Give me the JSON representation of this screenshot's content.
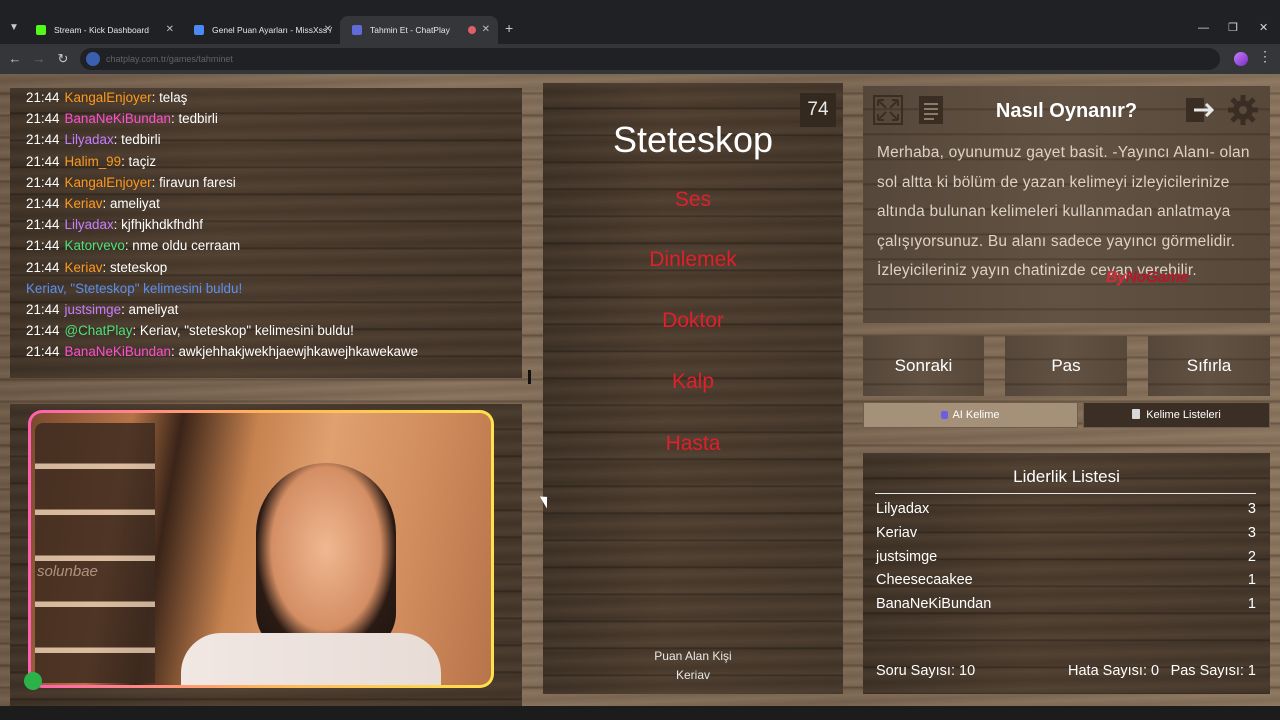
{
  "browser": {
    "tabs": [
      {
        "title": "Stream - Kick Dashboard",
        "favicon_color": "#53fc18",
        "active": false
      },
      {
        "title": "Genel Puan Ayarları - MissXss /",
        "favicon_color": "#4a8af4",
        "active": false
      },
      {
        "title": "Tahmin Et - ChatPlay",
        "favicon_color": "#5f6bd8",
        "active": true
      }
    ],
    "url": "chatplay.com.tr/games/tahminet",
    "new_tab_glyph": "+",
    "window_controls": [
      "—",
      "❐",
      "✕"
    ]
  },
  "chat": {
    "messages": [
      {
        "time": "21:44",
        "user": "KangalEnjoyer",
        "color": "#ff9a1f",
        "text": "telaş"
      },
      {
        "time": "21:44",
        "user": "BanaNeKiBundan",
        "color": "#ff4fd0",
        "text": "tedbirli"
      },
      {
        "time": "21:44",
        "user": "Lilyadax",
        "color": "#c77dff",
        "text": "tedbirli"
      },
      {
        "time": "21:44",
        "user": "Halim_99",
        "color": "#ff9a1f",
        "text": "taçiz"
      },
      {
        "time": "21:44",
        "user": "KangalEnjoyer",
        "color": "#ff9a1f",
        "text": "firavun faresi"
      },
      {
        "time": "21:44",
        "user": "Keriav",
        "color": "#ff9a1f",
        "text": "ameliyat"
      },
      {
        "time": "21:44",
        "user": "Lilyadax",
        "color": "#c77dff",
        "text": "kjfhjkhdkfhdhf"
      },
      {
        "time": "21:44",
        "user": "Katorvevo",
        "color": "#4ee07a",
        "text": "nme oldu cerraam"
      },
      {
        "time": "21:44",
        "user": "Keriav",
        "color": "#ff9a1f",
        "text": "steteskop"
      },
      {
        "system": true,
        "text": "Keriav, \"Steteskop\" kelimesini buldu!"
      },
      {
        "time": "21:44",
        "user": "justsimge",
        "color": "#c77dff",
        "text": "ameliyat"
      },
      {
        "time": "21:44",
        "user": "@ChatPlay",
        "color": "#4ee07a",
        "text": "Keriav, \"steteskop\" kelimesini buldu!"
      },
      {
        "time": "21:44",
        "user": "BanaNeKiBundan",
        "color": "#ff4fd0",
        "text": "awkjehhakjwekhjaewjhkawejhkawekawe"
      }
    ]
  },
  "webcam": {
    "overlay_text": "solunbae"
  },
  "game": {
    "timer": "74",
    "target_word": "Steteskop",
    "forbidden_words": [
      "Ses",
      "Dinlemek",
      "Doktor",
      "Kalp",
      "Hasta"
    ],
    "scorer_label": "Puan Alan Kişi",
    "scorer_name": "Keriav"
  },
  "howto": {
    "title": "Nasıl Oynanır?",
    "text": "Merhaba, oyunumuz gayet basit. -Yayıncı Alanı- olan sol altta ki bölüm de yazan kelimeyi izleyicilerinize altında bulunan kelimeleri kullanmadan anlatmaya çalışıyorsunuz. Bu alanı sadece yayıncı görmelidir. İzleyicileriniz yayın chatinizde cevap verebilir.",
    "logo_prefix": "By",
    "logo_suffix": "NoGame",
    "icons": [
      "fullscreen-icon",
      "document-icon",
      "logout-icon",
      "settings-icon"
    ]
  },
  "actions": {
    "next": "Sonraki",
    "pass": "Pas",
    "reset": "Sıfırla",
    "ai_word": "AI Kelime",
    "word_lists": "Kelime Listeleri"
  },
  "leaderboard": {
    "title": "Liderlik Listesi",
    "rows": [
      {
        "name": "Lilyadax",
        "score": "3"
      },
      {
        "name": "Keriav",
        "score": "3"
      },
      {
        "name": "justsimge",
        "score": "2"
      },
      {
        "name": "Cheesecaakee",
        "score": "1"
      },
      {
        "name": "BanaNeKiBundan",
        "score": "1"
      }
    ],
    "stats": {
      "questions": "Soru Sayısı: 10",
      "errors": "Hata Sayısı: 0",
      "passes": "Pas Sayısı: 1"
    }
  }
}
